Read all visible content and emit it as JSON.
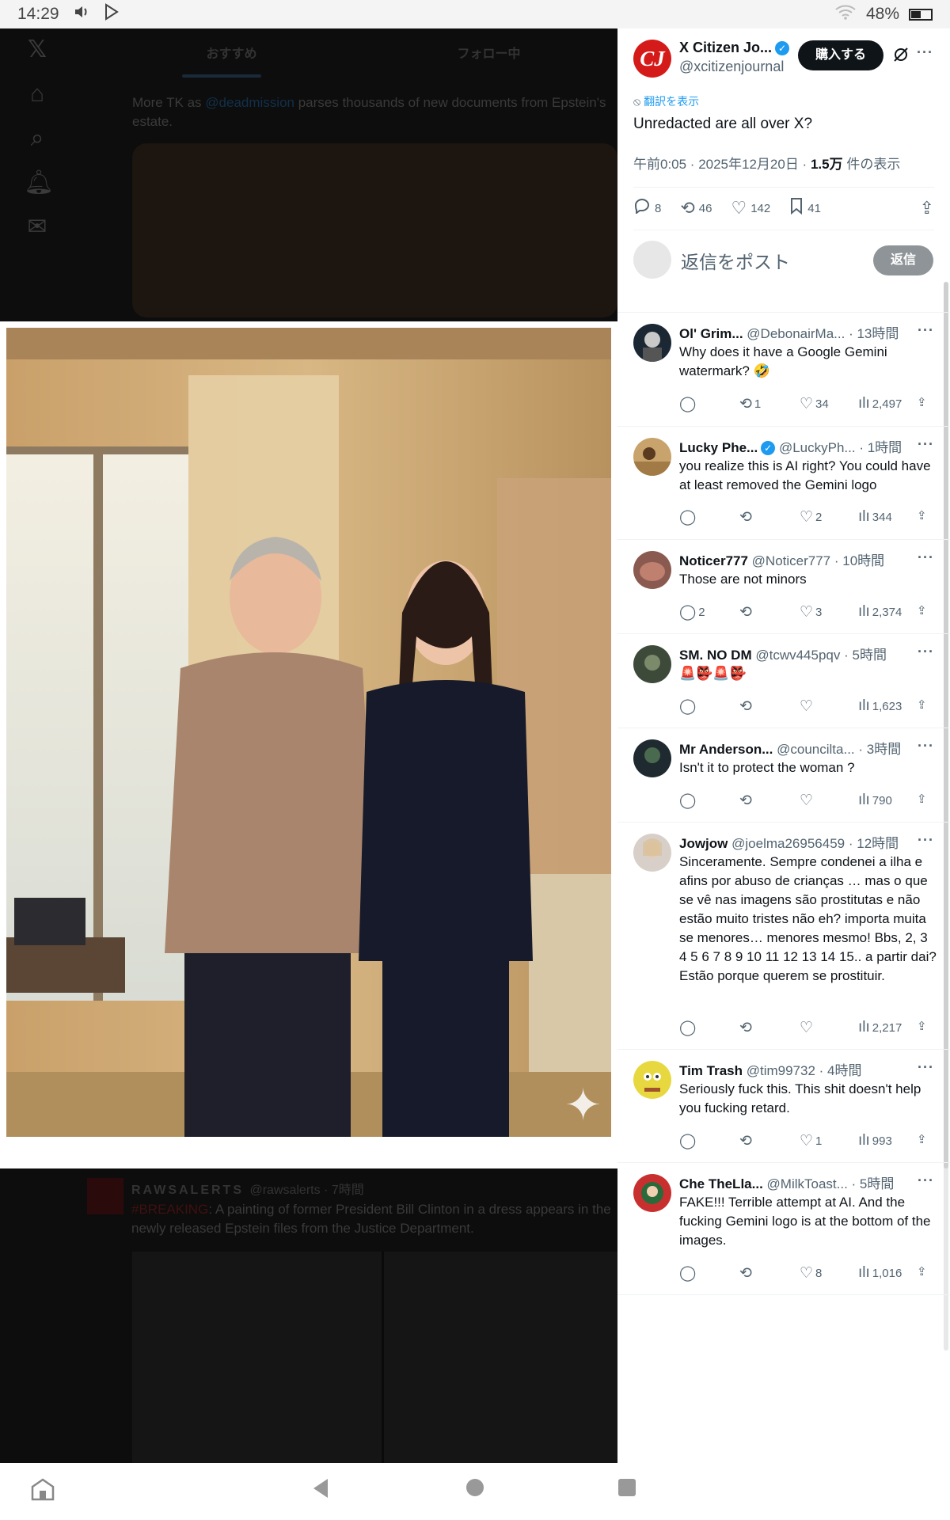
{
  "status_bar": {
    "time": "14:29",
    "battery": "48%",
    "icons": [
      "volume-icon",
      "play-store-icon",
      "wifi-icon",
      "battery-icon"
    ]
  },
  "feed": {
    "tabs": [
      "おすすめ",
      "フォロー中"
    ],
    "tweet1": {
      "text_prefix": "More TK as ",
      "text_link": "@deadmission",
      "text_suffix": " parses thousands of new documents from Epstein's estate."
    },
    "tweet2": {
      "name": "RAWSALERTS",
      "handle_time": "@rawsalerts · 7時間",
      "tag": "#BREAKING",
      "text": ": A painting of former President Bill Clinton in a dress appears in the newly released Epstein files from the Justice Department."
    }
  },
  "main_tweet": {
    "name": "X Citizen Jo...",
    "handle": "@xcitizenjournal",
    "avatar_text": "CJ",
    "buy_label": "購入する",
    "translate_label": "翻訳を表示",
    "text": "Unredacted are all over X?",
    "meta": "午前0:05 · 2025年12月20日 · ",
    "views_count": "1.5万",
    "views_label": " 件の表示",
    "actions": {
      "replies": "8",
      "reposts": "46",
      "likes": "142",
      "bookmarks": "41"
    }
  },
  "reply_box": {
    "placeholder": "返信をポスト",
    "button": "返信"
  },
  "replies": [
    {
      "name": "Ol' Grim...",
      "handle": "@DebonairMa...",
      "time": "· 13時間",
      "text": "Why does it have a Google Gemini watermark? 🤣",
      "replies": "",
      "reposts": "1",
      "likes": "34",
      "views": "2,497"
    },
    {
      "name": "Lucky Phe...",
      "handle": "@LuckyPh...",
      "time": "· 1時間",
      "text": "you realize this is AI right? You could have at least removed the Gemini logo",
      "replies": "",
      "reposts": "",
      "likes": "2",
      "views": "344"
    },
    {
      "name": "Noticer777",
      "handle": "@Noticer777",
      "time": "· 10時間",
      "text": "Those are not minors",
      "replies": "2",
      "reposts": "",
      "likes": "3",
      "views": "2,374"
    },
    {
      "name": "SM. NO DM",
      "handle": "@tcwv445pqv",
      "time": "· 5時間",
      "text": "🚨👺🚨👺",
      "replies": "",
      "reposts": "",
      "likes": "",
      "views": "1,623"
    },
    {
      "name": "Mr Anderson...",
      "handle": "@councilta...",
      "time": "· 3時間",
      "text": "Isn't it to protect the woman ?",
      "replies": "",
      "reposts": "",
      "likes": "",
      "views": "790"
    },
    {
      "name": "Jowjow",
      "handle": "@joelma26956459",
      "time": "· 12時間",
      "text": "Sinceramente. Sempre condenei a ilha e afins por abuso de crianças … mas o que se vê nas imagens são prostitutas e não estão muito tristes não eh? importa muita se menores… menores mesmo! Bbs, 2, 3 4 5 6 7 8 9 10 11 12 13 14 15.. a partir dai? Estão porque querem se prostituir.",
      "replies": "",
      "reposts": "",
      "likes": "",
      "views": "2,217"
    },
    {
      "name": "Tim Trash",
      "handle": "@tim99732",
      "time": "· 4時間",
      "text": "Seriously fuck this. This shit doesn't help you fucking retard.",
      "replies": "",
      "reposts": "",
      "likes": "1",
      "views": "993"
    },
    {
      "name": "Che TheLla...",
      "handle": "@MilkToast...",
      "time": "· 5時間",
      "text": "FAKE!!! Terrible attempt at AI. And the fucking Gemini logo is at the bottom of the images.",
      "replies": "",
      "reposts": "",
      "likes": "8",
      "views": "1,016"
    }
  ],
  "colors": {
    "accent": "#1d9bf0",
    "text": "#0f1419",
    "muted": "#536471",
    "cj_red": "#d51a1a"
  }
}
